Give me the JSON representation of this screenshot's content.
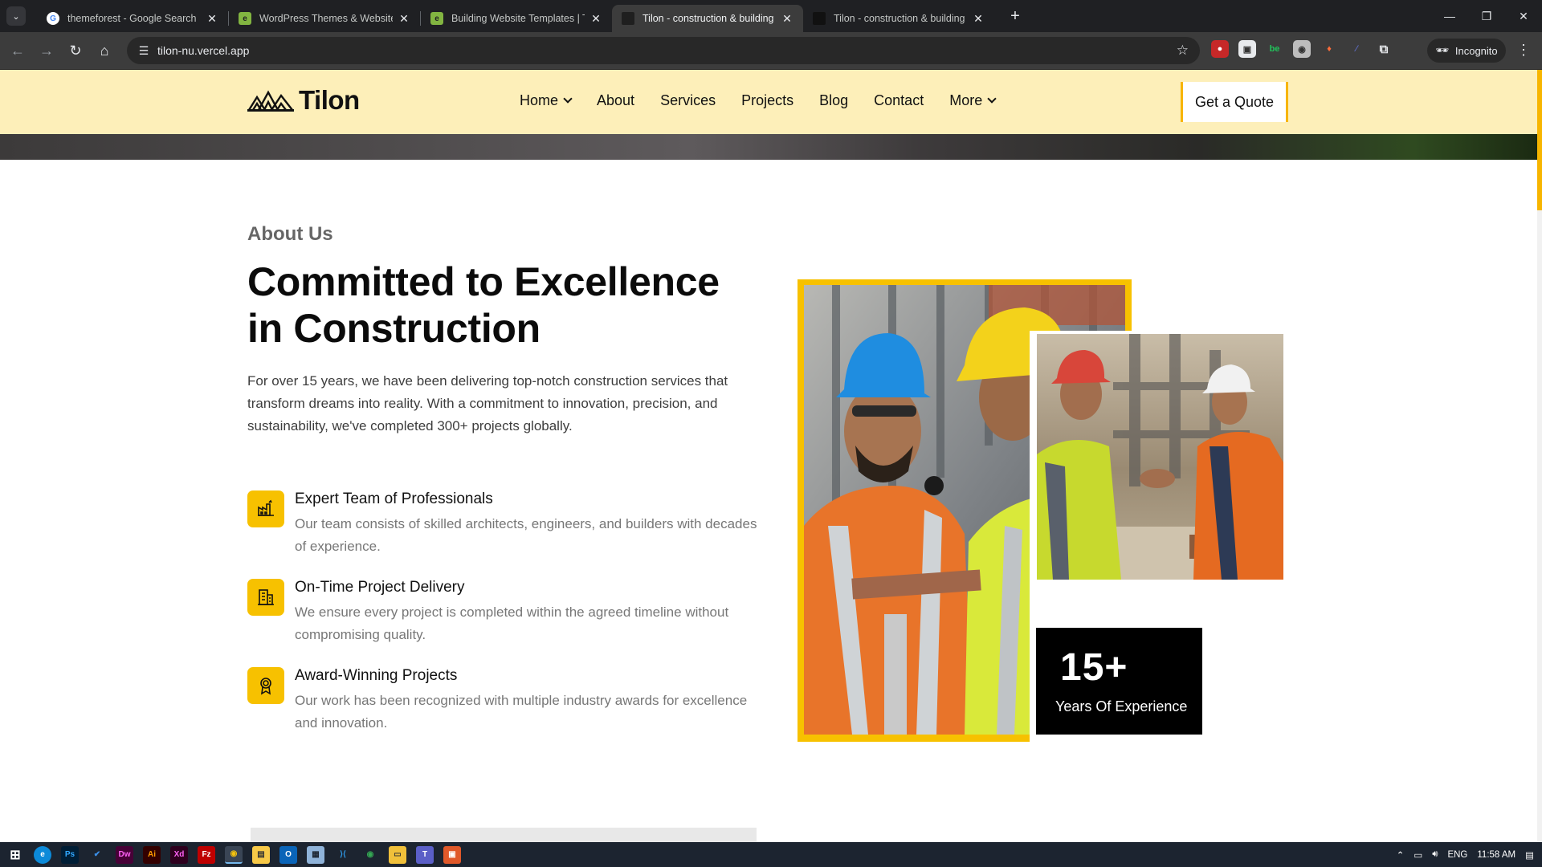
{
  "browser": {
    "tabs": [
      {
        "title": "themeforest - Google Search",
        "icon": "google-icon",
        "active": false
      },
      {
        "title": "WordPress Themes & Website T",
        "icon": "envato-icon",
        "active": false
      },
      {
        "title": "Building Website Templates | Th",
        "icon": "envato-icon",
        "active": false
      },
      {
        "title": "Tilon - construction & building",
        "icon": "tilon-icon",
        "active": true
      },
      {
        "title": "Tilon - construction & building",
        "icon": "tilon-icon",
        "active": false
      }
    ],
    "url": "tilon-nu.vercel.app",
    "incognito_label": "Incognito"
  },
  "site": {
    "logo_text": "Tilon",
    "nav": [
      {
        "label": "Home",
        "dropdown": true
      },
      {
        "label": "About",
        "dropdown": false
      },
      {
        "label": "Services",
        "dropdown": false
      },
      {
        "label": "Projects",
        "dropdown": false
      },
      {
        "label": "Blog",
        "dropdown": false
      },
      {
        "label": "Contact",
        "dropdown": false
      },
      {
        "label": "More",
        "dropdown": true
      }
    ],
    "quote_button": "Get a Quote",
    "accent_color": "#f7c100",
    "header_bg": "#fdefb9"
  },
  "about": {
    "kicker": "About Us",
    "title_line1": "Committed to Excellence",
    "title_line2": "in Construction",
    "description": "For over 15 years, we have been delivering top-notch construction services that transform dreams into reality. With a commitment to innovation, precision, and sustainability, we've completed 300+ projects globally.",
    "features": [
      {
        "title": "Expert Team of Professionals",
        "text": "Our team consists of skilled architects, engineers, and builders with decades of experience.",
        "icon": "factory-icon"
      },
      {
        "title": "On-Time Project Delivery",
        "text": "We ensure every project is completed within the agreed timeline without compromising quality.",
        "icon": "building-icon"
      },
      {
        "title": "Award-Winning Projects",
        "text": "Our work has been recognized with multiple industry awards for excellence and innovation.",
        "icon": "award-icon"
      }
    ],
    "stat_number": "15+",
    "stat_label": "Years Of Experience"
  },
  "taskbar": {
    "language": "ENG",
    "time": "11:58 AM"
  }
}
